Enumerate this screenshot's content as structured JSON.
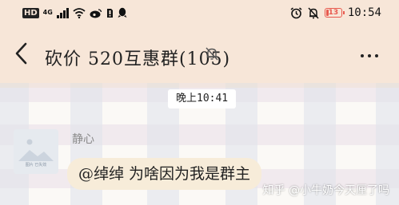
{
  "status_bar": {
    "hd_badge": "HD",
    "network": "4G",
    "time": "10:54",
    "battery_level": "13",
    "icons": [
      "signal-icon",
      "wifi-icon",
      "weibo-icon",
      "sim-icon",
      "qq-icon",
      "alarm-icon",
      "mute-icon",
      "battery-icon"
    ]
  },
  "header": {
    "title": "砍价 520互惠群(105)",
    "back_icon": "back-arrow-icon",
    "mute_icon": "bell-off-icon",
    "more_icon": "more-icon"
  },
  "chat": {
    "timestamp": "晚上10:41",
    "message": {
      "sender": "静心",
      "text": "@绰绰  为啥因为我是群主",
      "avatar_caption": "图片 已失效"
    }
  },
  "watermark": "知乎 @小牛奶今天厘了吗",
  "colors": {
    "header_bg": "#f7e6d8",
    "bubble_bg": "#f7ecd9",
    "battery": "#e85a4f"
  }
}
